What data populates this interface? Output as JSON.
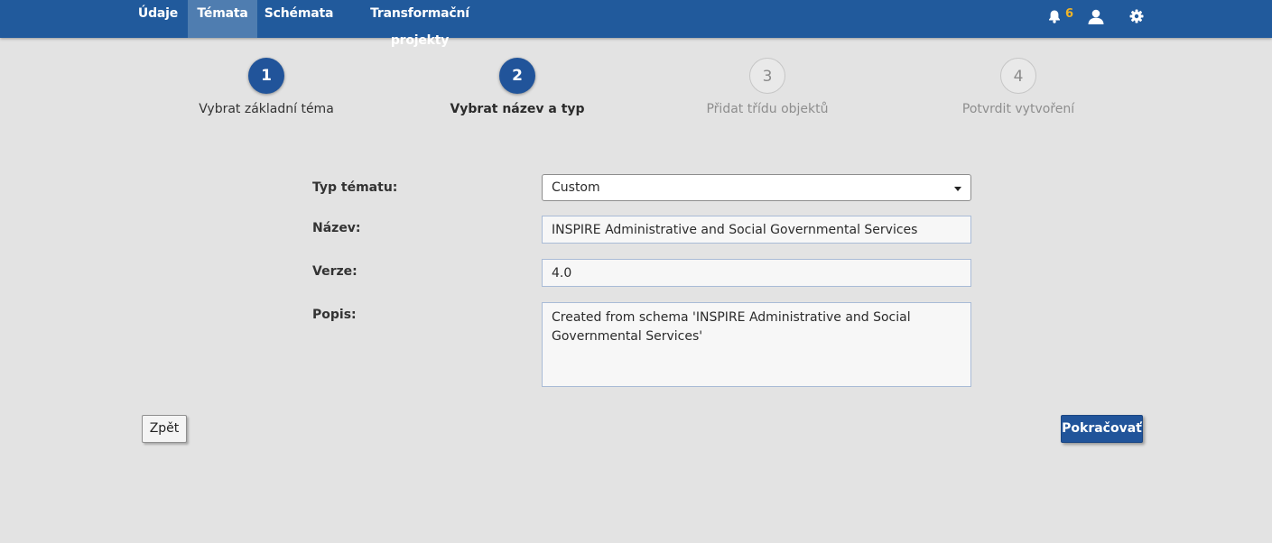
{
  "nav": {
    "tabs": [
      {
        "label": "Údaje"
      },
      {
        "label": "Témata"
      },
      {
        "label": "Schémata"
      },
      {
        "label": "Transformační projekty"
      }
    ],
    "active_tab": "Témata",
    "notifications_count": "6",
    "icons": [
      "bell-icon",
      "user-icon",
      "gear-icon"
    ],
    "accent_color": "#f0b428"
  },
  "stepper": {
    "steps": [
      {
        "number": "1",
        "label": "Vybrat základní téma",
        "state": "completed"
      },
      {
        "number": "2",
        "label": "Vybrat název a typ",
        "state": "active"
      },
      {
        "number": "3",
        "label": "Přidat třídu objektů",
        "state": "pending"
      },
      {
        "number": "4",
        "label": "Potvrdit vytvoření",
        "state": "pending"
      }
    ]
  },
  "form": {
    "type": {
      "label": "Typ tématu:",
      "value": "Custom"
    },
    "name": {
      "label": "Název:",
      "value": "INSPIRE Administrative and Social Governmental Services"
    },
    "version": {
      "label": "Verze:",
      "value": "4.0"
    },
    "description": {
      "label": "Popis:",
      "value": "Created from schema 'INSPIRE Administrative and Social Governmental Services'"
    }
  },
  "buttons": {
    "back": "Zpět",
    "continue": "Pokračovať"
  },
  "colors": {
    "header": "#215a9c",
    "active_tab": "#4f7db0",
    "primary": "#21549a",
    "background": "#e3e3e3"
  }
}
